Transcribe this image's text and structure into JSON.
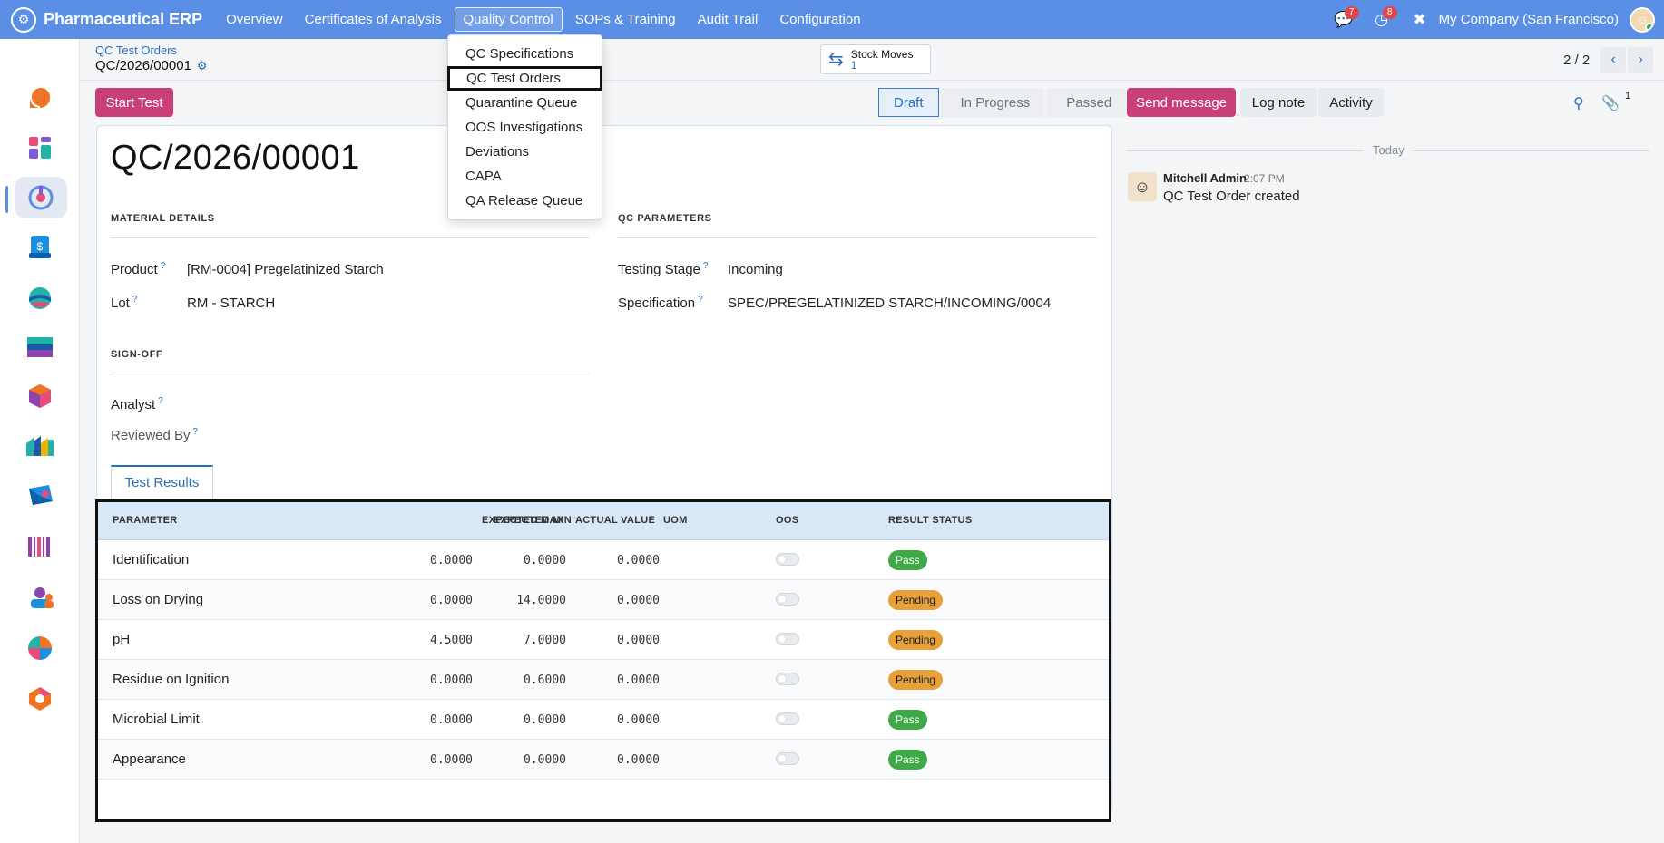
{
  "topbar": {
    "brand": "Pharmaceutical ERP",
    "menu": [
      "Overview",
      "Certificates of Analysis",
      "Quality Control",
      "SOPs & Training",
      "Audit Trail",
      "Configuration"
    ],
    "active_menu": "Quality Control",
    "messages_count": "7",
    "activities_count": "8",
    "company": "My Company (San Francisco)"
  },
  "dropdown": {
    "items": [
      "QC Specifications",
      "QC Test Orders",
      "Quarantine Queue",
      "OOS Investigations",
      "Deviations",
      "CAPA",
      "QA Release Queue"
    ],
    "focused": "QC Test Orders"
  },
  "breadcrumb": {
    "parent": "QC Test Orders",
    "current": "QC/2026/00001"
  },
  "smart_button": {
    "label": "Stock Moves",
    "count": "1"
  },
  "pager": {
    "text": "2 / 2"
  },
  "actions": {
    "start_test": "Start Test",
    "send_message": "Send message",
    "log_note": "Log note",
    "activity": "Activity",
    "followers_count": "1"
  },
  "statusbar": {
    "stages": [
      "Draft",
      "In Progress",
      "Passed"
    ],
    "current": "Draft"
  },
  "form": {
    "title": "QC/2026/00001",
    "material_section": "MATERIAL DETAILS",
    "qc_section": "QC PARAMETERS",
    "signoff_section": "SIGN-OFF",
    "product_label": "Product",
    "product_value": "[RM-0004] Pregelatinized Starch",
    "lot_label": "Lot",
    "lot_value": "RM - STARCH",
    "stage_label": "Testing Stage",
    "stage_value": "Incoming",
    "spec_label": "Specification",
    "spec_value": "SPEC/PREGELATINIZED STARCH/INCOMING/0004",
    "analyst_label": "Analyst",
    "reviewed_label": "Reviewed By",
    "help_mark": "?"
  },
  "tabs": {
    "test_results": "Test Results"
  },
  "table": {
    "headers": [
      "PARAMETER",
      "EXPECTED MIN",
      "EXPECTED MAX",
      "ACTUAL VALUE",
      "UOM",
      "OOS",
      "RESULT STATUS"
    ],
    "rows": [
      {
        "parameter": "Identification",
        "min": "0.0000",
        "max": "0.0000",
        "actual": "0.0000",
        "uom": "",
        "oos": false,
        "status": "Pass"
      },
      {
        "parameter": "Loss on Drying",
        "min": "0.0000",
        "max": "14.0000",
        "actual": "0.0000",
        "uom": "",
        "oos": false,
        "status": "Pending"
      },
      {
        "parameter": "pH",
        "min": "4.5000",
        "max": "7.0000",
        "actual": "0.0000",
        "uom": "",
        "oos": false,
        "status": "Pending"
      },
      {
        "parameter": "Residue on Ignition",
        "min": "0.0000",
        "max": "0.6000",
        "actual": "0.0000",
        "uom": "",
        "oos": false,
        "status": "Pending"
      },
      {
        "parameter": "Microbial Limit",
        "min": "0.0000",
        "max": "0.0000",
        "actual": "0.0000",
        "uom": "",
        "oos": false,
        "status": "Pass"
      },
      {
        "parameter": "Appearance",
        "min": "0.0000",
        "max": "0.0000",
        "actual": "0.0000",
        "uom": "",
        "oos": false,
        "status": "Pass"
      }
    ]
  },
  "chatter": {
    "date_separator": "Today",
    "author": "Mitchell Admin",
    "time": "2:07 PM",
    "body": "QC Test Order created"
  },
  "colors": {
    "navbar": "#5b8fe6",
    "primary": "#c93f7a",
    "link": "#2a6ebb",
    "pass": "#3fa847",
    "pending": "#e8a13a"
  }
}
